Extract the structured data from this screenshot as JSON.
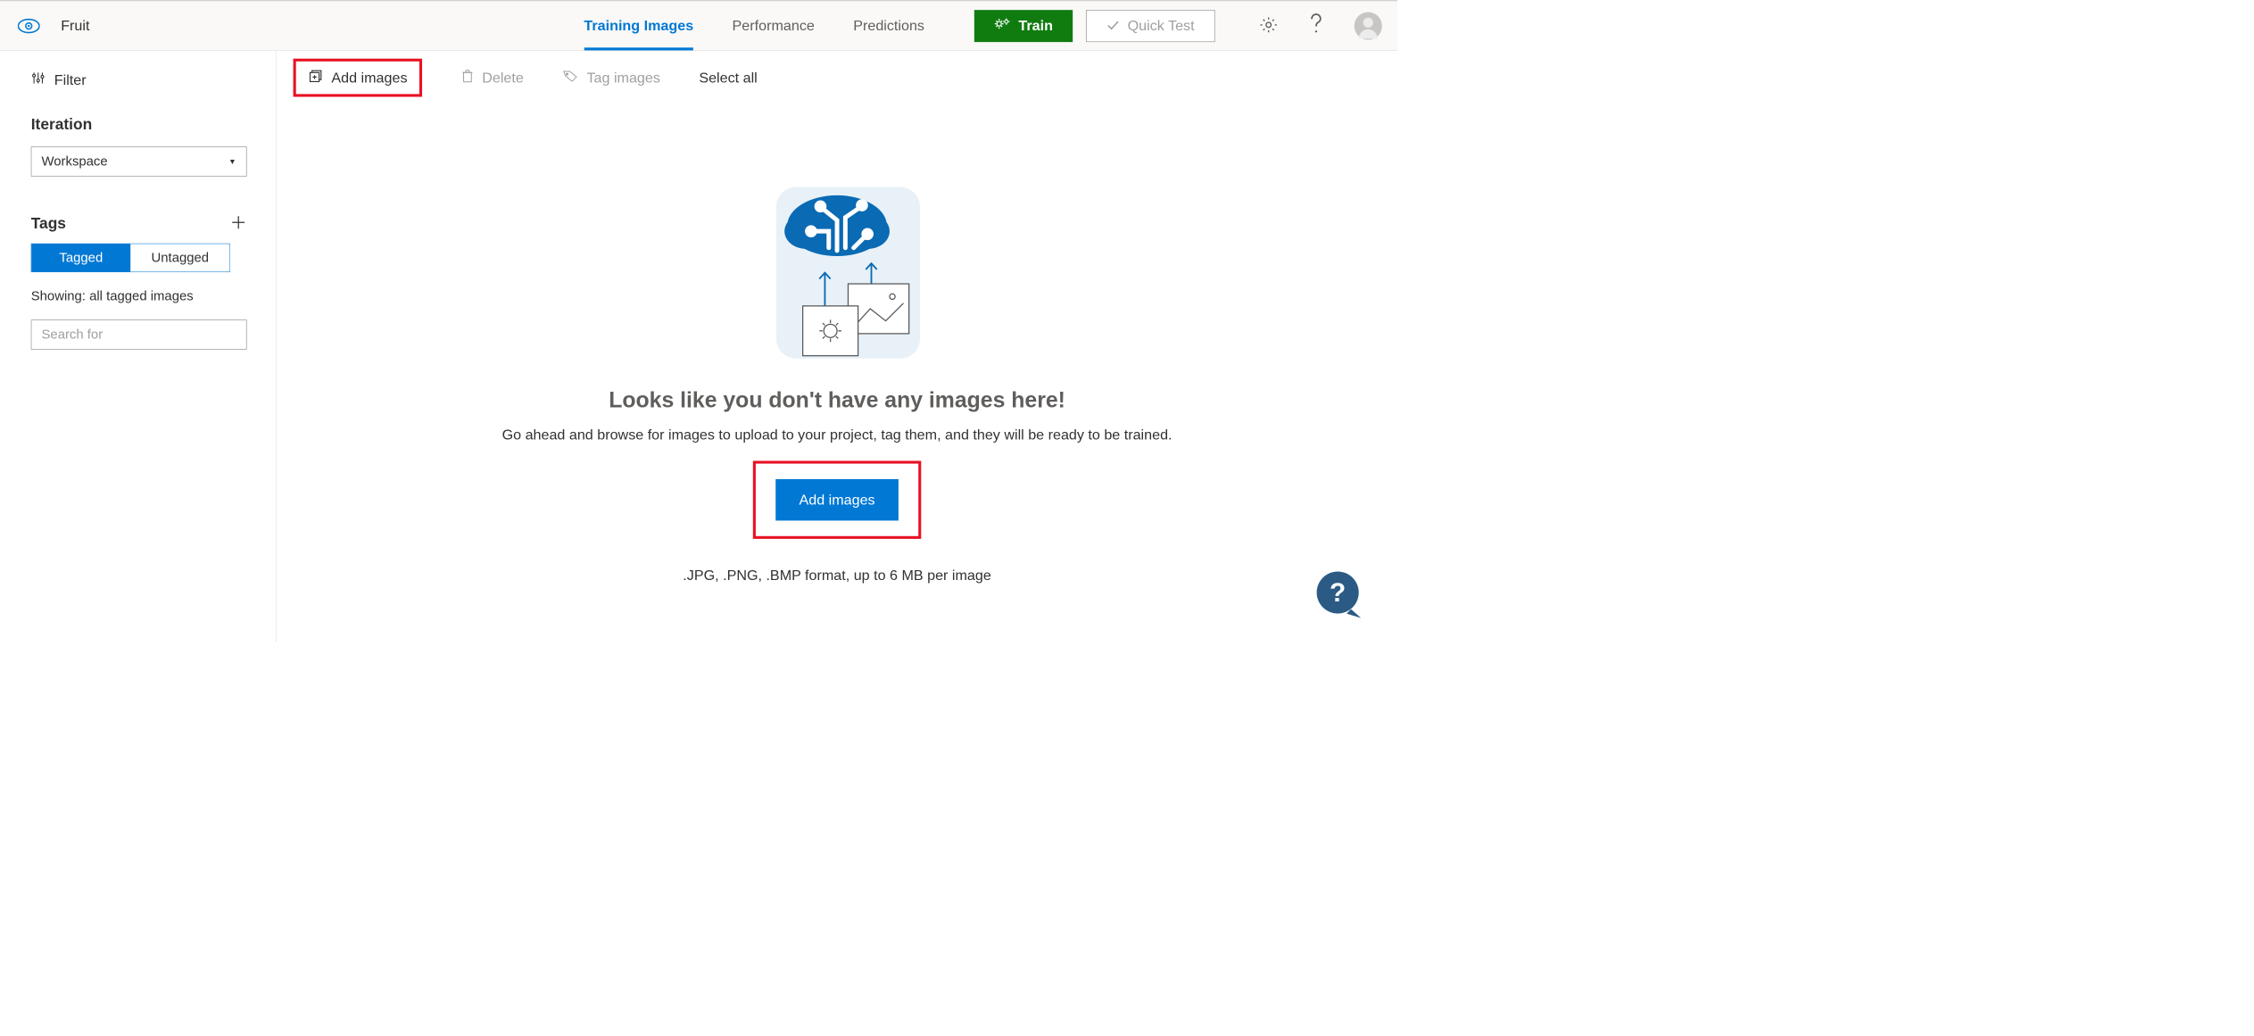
{
  "project_name": "Fruit",
  "nav": {
    "training_images": "Training Images",
    "performance": "Performance",
    "predictions": "Predictions"
  },
  "top_actions": {
    "train": "Train",
    "quick_test": "Quick Test"
  },
  "sidebar": {
    "filter": "Filter",
    "iteration_label": "Iteration",
    "iteration_value": "Workspace",
    "tags_label": "Tags",
    "toggle_tagged": "Tagged",
    "toggle_untagged": "Untagged",
    "showing": "Showing: all tagged images",
    "search_placeholder": "Search for"
  },
  "toolbar": {
    "add_images": "Add images",
    "delete": "Delete",
    "tag_images": "Tag images",
    "select_all": "Select all"
  },
  "empty": {
    "title": "Looks like you don't have any images here!",
    "subtitle": "Go ahead and browse for images to upload to your project, tag them, and they will be ready to be trained.",
    "cta": "Add images",
    "formats": ".JPG, .PNG, .BMP format, up to 6 MB per image"
  }
}
